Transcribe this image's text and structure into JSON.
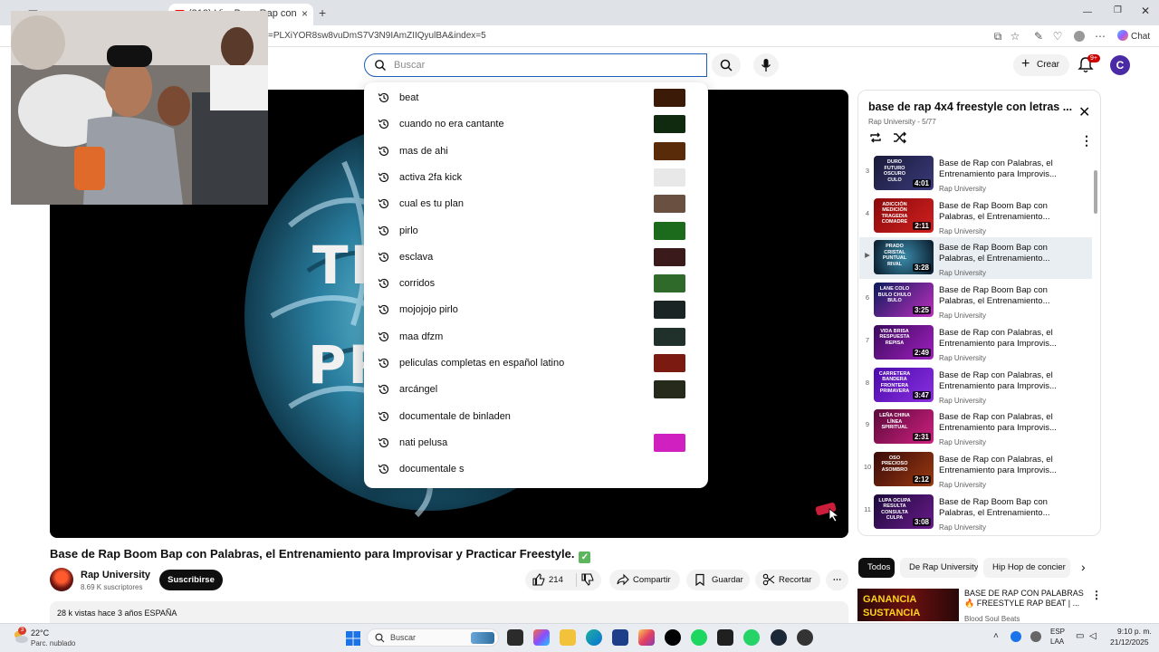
{
  "browser": {
    "tabs": [
      {
        "label": "​"
      },
      {
        "label": "(313) Vi... Base Rap con"
      }
    ],
    "url": "=PLXiYOR8sw8vuDmS7V3N9IAmZIIQyulBA&index=5",
    "chat_label": "Chat"
  },
  "header": {
    "search_placeholder": "Buscar",
    "create_label": "Crear",
    "notif_count": "9+",
    "avatar_letter": "C"
  },
  "player": {
    "overlay_line1": "TR",
    "overlay_line2": "PR"
  },
  "suggestions": [
    {
      "text": "beat",
      "color": "#3b1a08"
    },
    {
      "text": "cuando no era cantante",
      "color": "#102a10"
    },
    {
      "text": "mas de ahi",
      "color": "#5a2b08"
    },
    {
      "text": "activa 2fa kick",
      "color": "#e8e8e8"
    },
    {
      "text": "cual es tu plan",
      "color": "#6a5040"
    },
    {
      "text": "pirlo",
      "color": "#1c6b1c"
    },
    {
      "text": "esclava",
      "color": "#3a1a1a"
    },
    {
      "text": "corridos",
      "color": "#2f6a2a"
    },
    {
      "text": "mojojojo pirlo",
      "color": "#1a2424"
    },
    {
      "text": "maa dfzm",
      "color": "#20302a"
    },
    {
      "text": "peliculas completas en español latino",
      "color": "#7a1a10"
    },
    {
      "text": "arcángel",
      "color": "#262a1a"
    },
    {
      "text": "documentale de binladen",
      "color": ""
    },
    {
      "text": "nati pelusa",
      "color": "#d020c0"
    },
    {
      "text": "documentale s",
      "color": ""
    }
  ],
  "video": {
    "title": "Base de Rap Boom Bap con Palabras, el Entrenamiento para Improvisar y Practicar Freestyle.",
    "check_glyph": "✓",
    "channel": "Rap University",
    "subscribers": "8.69 K suscriptores",
    "subscribe_label": "Suscribirse",
    "likes": "214",
    "share_label": "Compartir",
    "save_label": "Guardar",
    "clip_label": "Recortar",
    "description_line": "28 k vistas  hace 3 años  ESPAÑA"
  },
  "playlist": {
    "title": "base de rap 4x4 freestyle con letras ...",
    "subtitle": "Rap University - 5/77",
    "items": [
      {
        "num": "3",
        "title": "Base de Rap con Palabras, el Entrenamiento para Improvis...",
        "channel": "Rap University",
        "duration": "4:01",
        "thumb_words": "DURO FUTURO OSCURO CULO",
        "bg": "linear-gradient(135deg,#1a1a3a,#3a3a7a)"
      },
      {
        "num": "4",
        "title": "Base de Rap Boom Bap con Palabras, el Entrenamiento...",
        "channel": "Rap University",
        "duration": "2:11",
        "thumb_words": "ADICCIÓN MEDICIÓN TRAGEDIA COMADRE",
        "bg": "linear-gradient(135deg,#8a0a0a,#d02020)"
      },
      {
        "num": "▶",
        "title": "Base de Rap Boom Bap con Palabras, el Entrenamiento...",
        "channel": "Rap University",
        "duration": "3:28",
        "thumb_words": "PRADO CRISTAL PUNTUAL RIVAL",
        "bg": "radial-gradient(circle,#3a8aaa,#0a1a2a)"
      },
      {
        "num": "6",
        "title": "Base de Rap Boom Bap con Palabras, el Entrenamiento...",
        "channel": "Rap University",
        "duration": "3:25",
        "thumb_words": "LANE COLO BULO CHULO BULO",
        "bg": "linear-gradient(135deg,#0a1a5a,#c030c0)"
      },
      {
        "num": "7",
        "title": "Base de Rap con Palabras, el Entrenamiento para Improvis...",
        "channel": "Rap University",
        "duration": "2:49",
        "thumb_words": "VIDA BRISA RESPUESTA REPISA",
        "bg": "linear-gradient(135deg,#3a0a5a,#a020c0)"
      },
      {
        "num": "8",
        "title": "Base de Rap con Palabras, el Entrenamiento para Improvis...",
        "channel": "Rap University",
        "duration": "3:47",
        "thumb_words": "CARRETERA BANDERA FRONTERA PRIMAVERA",
        "bg": "linear-gradient(135deg,#4a0aaa,#8a30e0)"
      },
      {
        "num": "9",
        "title": "Base de Rap con Palabras, el Entrenamiento para Improvis...",
        "channel": "Rap University",
        "duration": "2:31",
        "thumb_words": "LEÑA CHINA LÍNEA SPIRITUAL",
        "bg": "linear-gradient(135deg,#5a0a3a,#d02080)"
      },
      {
        "num": "10",
        "title": "Base de Rap con Palabras, el Entrenamiento para Improvis...",
        "channel": "Rap University",
        "duration": "2:12",
        "thumb_words": "OSO PRECIOSO ASOMBRO",
        "bg": "linear-gradient(135deg,#3a0a0a,#9a3a10)"
      },
      {
        "num": "11",
        "title": "Base de Rap Boom Bap con Palabras, el Entrenamiento...",
        "channel": "Rap University",
        "duration": "3:08",
        "thumb_words": "LUPA OCUPA RESULTA CONSULTA CULPA",
        "bg": "linear-gradient(135deg,#1a0a3a,#6a1a8a)"
      }
    ]
  },
  "chips": [
    "Todos",
    "De Rap University",
    "Hip Hop de concier"
  ],
  "recommended": {
    "thumb_line1": "GANANCIA",
    "thumb_line2": "SUSTANCIA",
    "title": "BASE DE RAP CON PALABRAS 🔥 FREESTYLE RAP BEAT | ...",
    "channel": "Blood Soul Beats"
  },
  "taskbar": {
    "weather_temp": "22°C",
    "weather_desc": "Parc. nublado",
    "search_label": "Buscar",
    "lang1": "ESP",
    "lang2": "LAA",
    "time": "9:10 p. m.",
    "date": "21/12/2025"
  }
}
